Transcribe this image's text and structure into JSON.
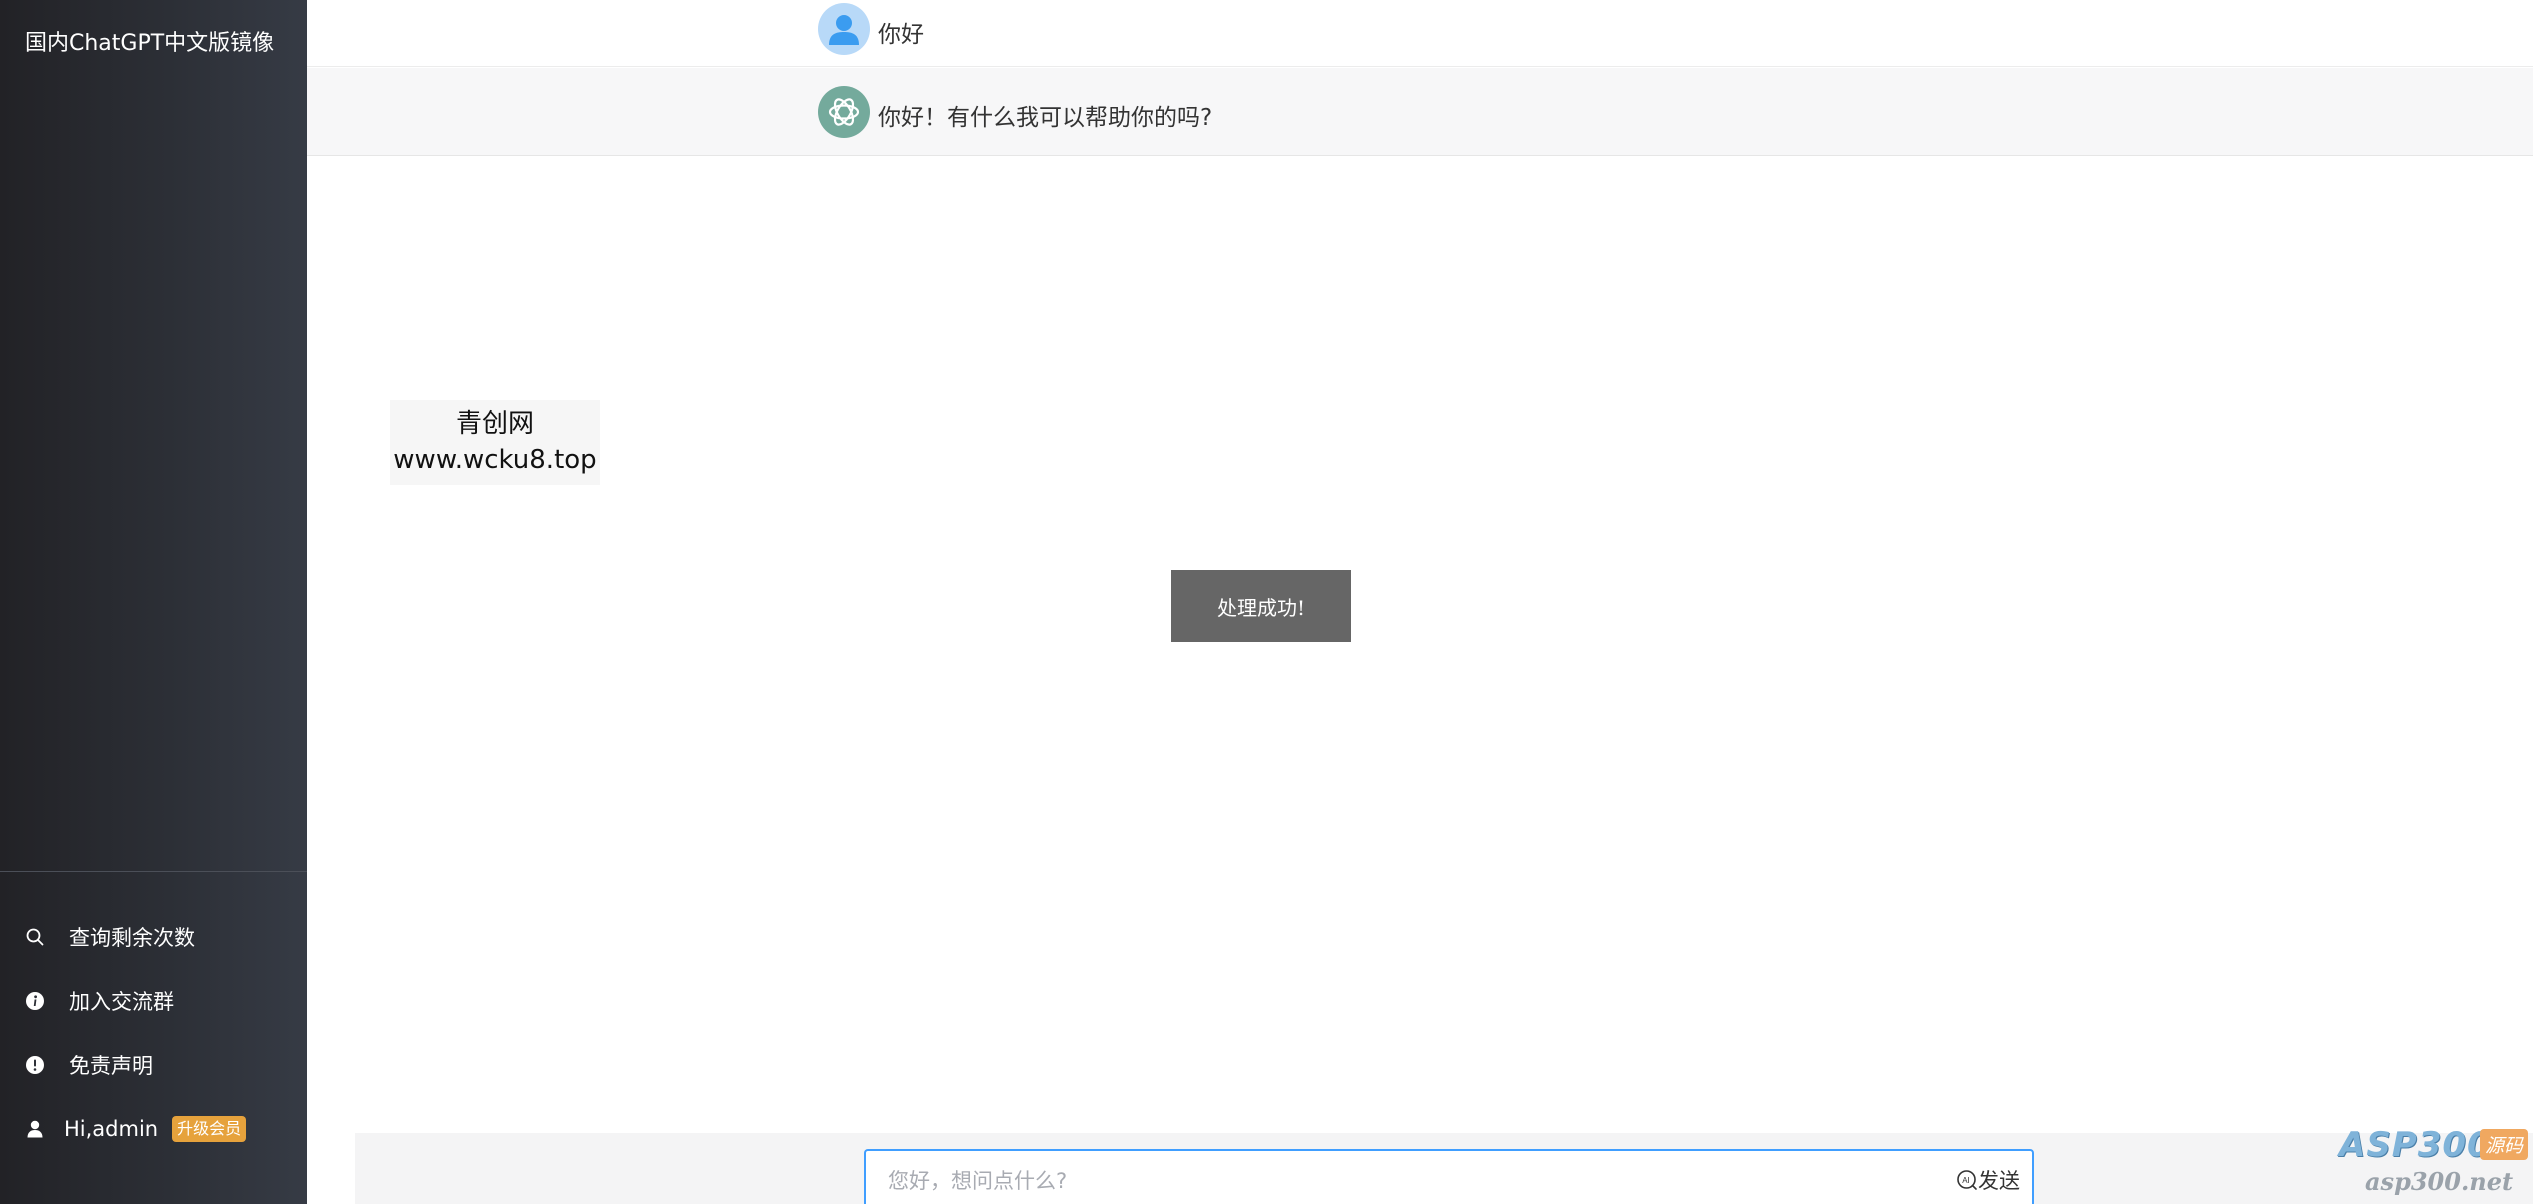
{
  "sidebar": {
    "brand": "国内ChatGPT中文版镜像",
    "menu": [
      {
        "label": "查询剩余次数",
        "icon": "search-icon"
      },
      {
        "label": "加入交流群",
        "icon": "info-icon"
      },
      {
        "label": "免责声明",
        "icon": "alert-icon"
      }
    ],
    "user": {
      "greeting": "Hi,admin",
      "badge": "升级会员",
      "icon": "user-icon"
    }
  },
  "chat": {
    "messages": [
      {
        "role": "user",
        "text": "你好",
        "avatar_icon": "user-avatar-icon"
      },
      {
        "role": "assistant",
        "text": "你好！有什么我可以帮助你的吗?",
        "avatar_icon": "openai-logo-icon"
      }
    ]
  },
  "watermark": {
    "line1": "青创网",
    "line2": "www.wcku8.top"
  },
  "toast": {
    "text": "处理成功!"
  },
  "input": {
    "placeholder": "您好，想问点什么?",
    "value": "",
    "send_label": "发送"
  },
  "site_logo": {
    "main": "ASP300",
    "tag": "源码",
    "url": "asp300.net"
  },
  "colors": {
    "sidebar_bg": "#2c2f36",
    "accent": "#409eff",
    "badge": "#e6a23c",
    "bot_avatar": "#74aa9c",
    "toast_bg": "#666666"
  }
}
